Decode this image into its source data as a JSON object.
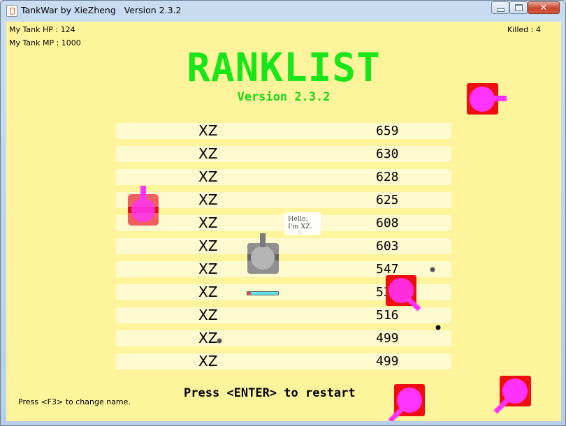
{
  "window": {
    "title": "TankWar by XieZheng   Version 2.3.2",
    "controls": [
      "minimize",
      "maximize",
      "close"
    ],
    "close_glyph": "✕"
  },
  "hud": {
    "hp_label": "My Tank HP : 124",
    "mp_label": "My Tank MP : 1000",
    "killed_label": "Killed : 4"
  },
  "ranklist": {
    "title": "RANKLIST",
    "version": "Version 2.3.2",
    "entries": [
      {
        "name": "XZ",
        "score": "659"
      },
      {
        "name": "XZ",
        "score": "630"
      },
      {
        "name": "XZ",
        "score": "628"
      },
      {
        "name": "XZ",
        "score": "625"
      },
      {
        "name": "XZ",
        "score": "608"
      },
      {
        "name": "XZ",
        "score": "603"
      },
      {
        "name": "XZ",
        "score": "547"
      },
      {
        "name": "XZ",
        "score": "532"
      },
      {
        "name": "XZ",
        "score": "516"
      },
      {
        "name": "XZ",
        "score": "499"
      },
      {
        "name": "XZ",
        "score": "499"
      }
    ]
  },
  "prompts": {
    "restart": "Press <ENTER> to restart",
    "change_name": "Press <F3> to change name."
  },
  "speech_bubble": "Hello,\nI'm XZ.",
  "my_tank": {
    "hp": 124,
    "mp": 1000
  },
  "colors": {
    "background": "#fdf49c",
    "title_green": "#19e619",
    "enemy_body": "#ee1010",
    "enemy_turret": "#ff33ff",
    "player_body": "#8f8f8f",
    "bullet": "#555555"
  }
}
